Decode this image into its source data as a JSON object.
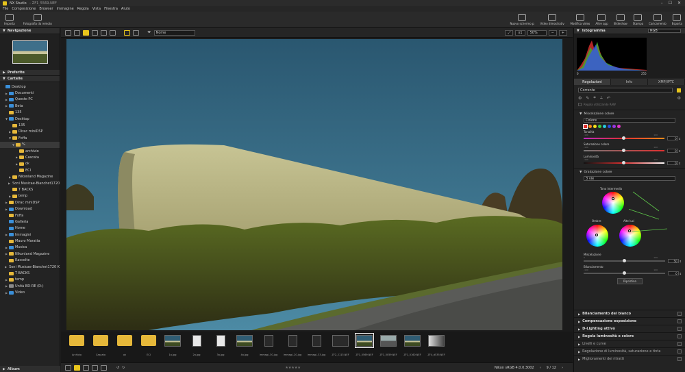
{
  "window": {
    "title": "NX Studio",
    "doc": "– ZF1_5569.NEF"
  },
  "menu": [
    "File",
    "Composizione",
    "Browser",
    "Immagine",
    "Regola",
    "Vista",
    "Finestra",
    "Aiuto"
  ],
  "toolbar": {
    "left": [
      {
        "label": "Importa",
        "icon": "import-icon"
      },
      {
        "label": "Fotografia da remoto",
        "icon": "remote-camera-icon"
      }
    ],
    "right": [
      {
        "label": "Nuovo schermo panoramico",
        "icon": "panorama-icon"
      },
      {
        "label": "Video dimostrativo",
        "icon": "reel-icon"
      },
      {
        "label": "Modifica video",
        "icon": "video-edit-icon"
      },
      {
        "label": "Altre app",
        "icon": "apps-icon"
      },
      {
        "label": "Slideshow",
        "icon": "slideshow-icon"
      },
      {
        "label": "Stampa",
        "icon": "print-icon"
      },
      {
        "label": "Caricamento",
        "icon": "upload-icon"
      },
      {
        "label": "Esporta",
        "icon": "export-icon"
      }
    ]
  },
  "left_panel": {
    "navigation": "Navigazione",
    "favorites": "Preferite",
    "folders": "Cartelle",
    "album": "Album",
    "tree": [
      {
        "label": "Desktop",
        "depth": 0,
        "type": "blue",
        "arrow": ""
      },
      {
        "label": "Documenti",
        "depth": 1,
        "type": "blue",
        "arrow": "▶"
      },
      {
        "label": "Questo PC",
        "depth": 1,
        "type": "blue",
        "arrow": "▶"
      },
      {
        "label": "Beta",
        "depth": 1,
        "type": "blue",
        "arrow": "▶"
      },
      {
        "label": "135",
        "depth": 1,
        "type": "yellow",
        "arrow": ""
      },
      {
        "label": "Desktop",
        "depth": 1,
        "type": "blue",
        "arrow": "▼"
      },
      {
        "label": "135",
        "depth": 2,
        "type": "yellow",
        "arrow": ""
      },
      {
        "label": "Dirac miniDSP",
        "depth": 2,
        "type": "yellow",
        "arrow": "▶"
      },
      {
        "label": "Foffa",
        "depth": 2,
        "type": "yellow",
        "arrow": "▼"
      },
      {
        "label": "%",
        "depth": 3,
        "type": "yellow",
        "arrow": "▼",
        "selected": true
      },
      {
        "label": "archivio",
        "depth": 4,
        "type": "yellow",
        "arrow": ""
      },
      {
        "label": "Cascata",
        "depth": 4,
        "type": "yellow",
        "arrow": "▶"
      },
      {
        "label": "ok",
        "depth": 4,
        "type": "yellow",
        "arrow": "▶"
      },
      {
        "label": "ECI",
        "depth": 4,
        "type": "yellow",
        "arrow": ""
      },
      {
        "label": "Nikonland Magazine",
        "depth": 2,
        "type": "yellow",
        "arrow": "▶"
      },
      {
        "label": "Soni Musicae-Bianchet1720 K",
        "depth": 2,
        "type": "yellow",
        "arrow": "▶"
      },
      {
        "label": "T BACKS",
        "depth": 2,
        "type": "yellow",
        "arrow": ""
      },
      {
        "label": "temp",
        "depth": 2,
        "type": "yellow",
        "arrow": "▶"
      },
      {
        "label": "Dirac miniDSP",
        "depth": 1,
        "type": "yellow",
        "arrow": "▶"
      },
      {
        "label": "Download",
        "depth": 1,
        "type": "blue",
        "arrow": "▶"
      },
      {
        "label": "Foffa",
        "depth": 1,
        "type": "yellow",
        "arrow": ""
      },
      {
        "label": "Galleria",
        "depth": 1,
        "type": "blue",
        "arrow": ""
      },
      {
        "label": "Home",
        "depth": 1,
        "type": "blue",
        "arrow": ""
      },
      {
        "label": "Immagini",
        "depth": 1,
        "type": "blue",
        "arrow": "▶"
      },
      {
        "label": "Mauro Maratta",
        "depth": 1,
        "type": "yellow",
        "arrow": ""
      },
      {
        "label": "Musica",
        "depth": 1,
        "type": "blue",
        "arrow": "▶"
      },
      {
        "label": "Nikonland Magazine",
        "depth": 1,
        "type": "yellow",
        "arrow": "▶"
      },
      {
        "label": "Raccolte",
        "depth": 1,
        "type": "yellow",
        "arrow": ""
      },
      {
        "label": "Soni Musicae-Bianchet1720 K2",
        "depth": 1,
        "type": "yellow",
        "arrow": "▶"
      },
      {
        "label": "T BACKS",
        "depth": 1,
        "type": "yellow",
        "arrow": ""
      },
      {
        "label": "temp",
        "depth": 1,
        "type": "yellow",
        "arrow": "▶"
      },
      {
        "label": "Unità BD-RE (D:)",
        "depth": 1,
        "type": "gray",
        "arrow": "▶"
      },
      {
        "label": "Video",
        "depth": 1,
        "type": "blue",
        "arrow": "▶"
      }
    ]
  },
  "viewbar": {
    "sort": "Nome",
    "zoom": "50%",
    "fit": "x1"
  },
  "filmstrip": [
    {
      "name": "Archivio",
      "kind": "folder"
    },
    {
      "name": "Cascata",
      "kind": "folder"
    },
    {
      "name": "ok",
      "kind": "folder"
    },
    {
      "name": "ECI",
      "kind": "folder"
    },
    {
      "name": "1a.jpg",
      "kind": "landscape"
    },
    {
      "name": "2a.jpg",
      "kind": "doc"
    },
    {
      "name": "3a.jpg",
      "kind": "doc"
    },
    {
      "name": "4a.jpg",
      "kind": "landscape"
    },
    {
      "name": "immagi..30.jpg",
      "kind": "dark"
    },
    {
      "name": "immagi..20.jpg",
      "kind": "dark"
    },
    {
      "name": "immagi..33.jpg",
      "kind": "dark"
    },
    {
      "name": "ZF2_2113.NEF",
      "kind": "dark"
    },
    {
      "name": "ZF1_5569.NEF",
      "kind": "landscape",
      "selected": true
    },
    {
      "name": "ZF1_5059.NEF",
      "kind": "gray"
    },
    {
      "name": "ZF1_5160.NEF",
      "kind": "landscape"
    },
    {
      "name": "ZF4_d535.NEF",
      "kind": "bw"
    }
  ],
  "status": {
    "profile": "Nikon sRGB 4.0.0.3002",
    "page": "9 / 12"
  },
  "right_panel": {
    "histogram_title": "Istogramma",
    "histogram_channel": "RGB",
    "hist_min": "0",
    "hist_max": "255",
    "tabs": [
      "Regolazioni",
      "Info",
      "XMP/IPTC"
    ],
    "preset": "Corrente",
    "use_raw": "Regola utilizzando RAW",
    "mixer": {
      "title": "Miscelazione colore",
      "mode": "Colore",
      "swatches": [
        "#e03030",
        "#ff8c1a",
        "#f5e11b",
        "#3fcf3f",
        "#28c8e0",
        "#2a4ee0",
        "#9b36e0",
        "#e035c8"
      ],
      "sliders": [
        {
          "label": "Tonalità",
          "min": "-100",
          "max": "100",
          "value": "0",
          "pos": 0.5
        },
        {
          "label": "Saturazione colore",
          "min": "-100",
          "max": "100",
          "value": "0",
          "pos": 0.5
        },
        {
          "label": "Luminosità",
          "min": "-100",
          "max": "100",
          "value": "0",
          "pos": 0.5
        }
      ]
    },
    "grading": {
      "title": "Gradazione colore",
      "mode": "3 vie",
      "mid": "Tono intermedio",
      "shadows": "Ombre",
      "highlights": "Alte luci",
      "blend": {
        "label": "Miscelazione",
        "min": "0",
        "max": "100",
        "value": "50",
        "pos": 0.5
      },
      "balance": {
        "label": "Bilanciamento",
        "min": "-100",
        "max": "100",
        "value": "0",
        "pos": 0.5
      },
      "reset": "Ripristina"
    },
    "sections": [
      {
        "label": "Bilanciamento del bianco",
        "badge": "",
        "bold": true
      },
      {
        "label": "Compensazione esposizione",
        "badge": "",
        "bold": true
      },
      {
        "label": "D-Lighting attivo",
        "badge": "",
        "bold": true
      },
      {
        "label": "Regola luminosità e colore",
        "badge": "",
        "bold": true
      },
      {
        "label": "Livelli e curve",
        "badge": "",
        "bold": false
      },
      {
        "label": "Regolazione di luminosità, saturazione e tinta",
        "badge": "",
        "bold": false
      },
      {
        "label": "Miglioramenti dei ritratti",
        "badge": "",
        "bold": false
      }
    ]
  }
}
